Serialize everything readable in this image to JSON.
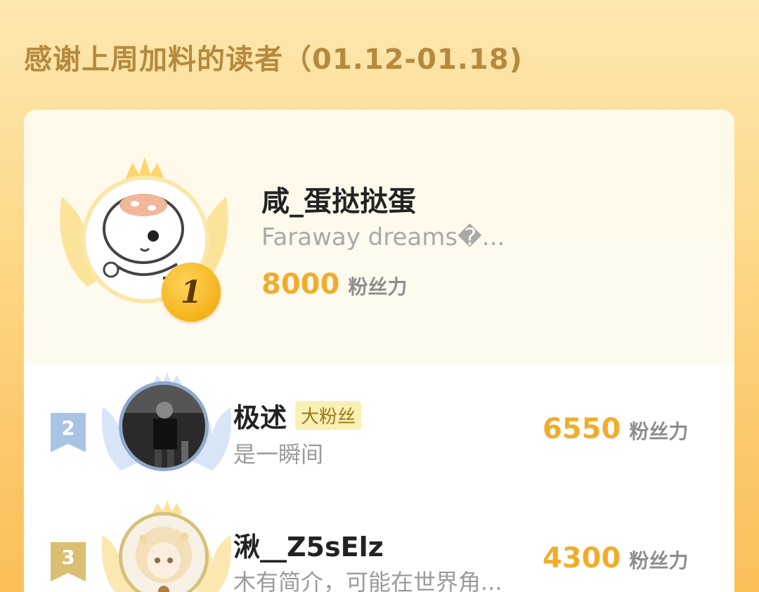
{
  "page": {
    "title": "感谢上周加料的读者（01.12-01.18)"
  },
  "colors": {
    "accent": "#f0ad2c",
    "title": "#b58a3e",
    "fan_badge_bg": "#fbf0b3"
  },
  "score_unit": "粉丝力",
  "top_reader": {
    "rank": "1",
    "name": "咸_蛋挞挞蛋",
    "description": "Faraway dreams�...",
    "score": "8000",
    "avatar_icon": "hamster-astronaut-avatar"
  },
  "readers": [
    {
      "rank": "2",
      "name": "极述",
      "badge": "大粉丝",
      "description": "是一瞬间",
      "score": "6550",
      "avatar_icon": "dark-photo-avatar"
    },
    {
      "rank": "3",
      "name": "湫__Z5sElz",
      "badge": "",
      "description": "木有简介，可能在世界角...",
      "score": "4300",
      "avatar_icon": "anime-girl-avatar"
    }
  ]
}
